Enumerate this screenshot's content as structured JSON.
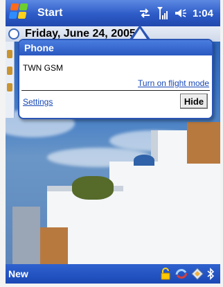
{
  "taskbar": {
    "title": "Start",
    "time": "1:04",
    "icons": [
      "windows-start-icon",
      "connectivity-icon",
      "signal-strength-icon",
      "volume-icon"
    ]
  },
  "today": {
    "date_text": "Friday, June 24, 2005"
  },
  "phone_popup": {
    "title": "Phone",
    "network": "TWN GSM",
    "flight_mode_link": "Turn on flight mode",
    "settings_link": "Settings",
    "hide_button": "Hide"
  },
  "bottom_bar": {
    "new_label": "New",
    "tray_icons": [
      "lock-icon",
      "sync-icon",
      "wireless-icon",
      "bluetooth-icon"
    ]
  },
  "colors": {
    "taskbar_blue": "#2d5bc7",
    "link_blue": "#1747b6",
    "popup_border": "#2a55b4"
  }
}
